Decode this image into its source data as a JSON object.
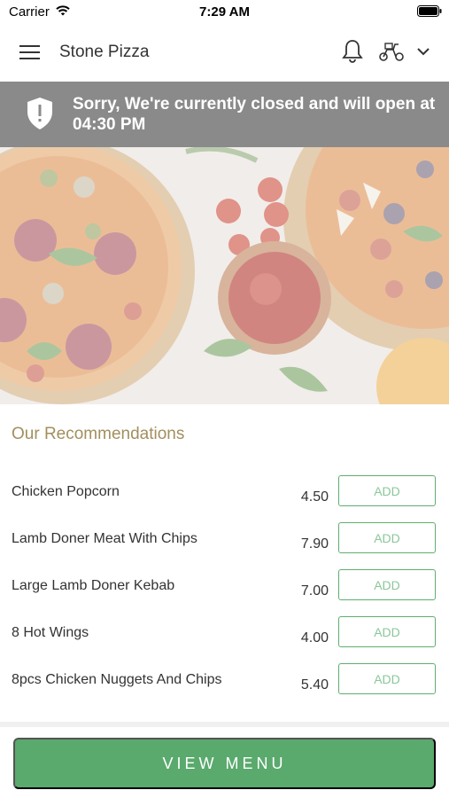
{
  "status": {
    "carrier": "Carrier",
    "time": "7:29 AM"
  },
  "header": {
    "title": "Stone Pizza"
  },
  "banner": {
    "message": "Sorry, We're currently closed and will open at 04:30 PM"
  },
  "recommendations": {
    "title": "Our Recommendations",
    "add_label": "ADD",
    "items": [
      {
        "name": "Chicken Popcorn",
        "price": "4.50"
      },
      {
        "name": "Lamb Doner Meat With Chips",
        "price": "7.90"
      },
      {
        "name": "Large Lamb Doner Kebab",
        "price": "7.00"
      },
      {
        "name": "8 Hot Wings",
        "price": "4.00"
      },
      {
        "name": "8pcs Chicken Nuggets And Chips",
        "price": "5.40"
      }
    ]
  },
  "footer": {
    "view_menu_label": "VIEW MENU"
  },
  "colors": {
    "accent": "#5aa96d",
    "banner": "#8a8a8a",
    "section_title": "#a38f5e"
  }
}
